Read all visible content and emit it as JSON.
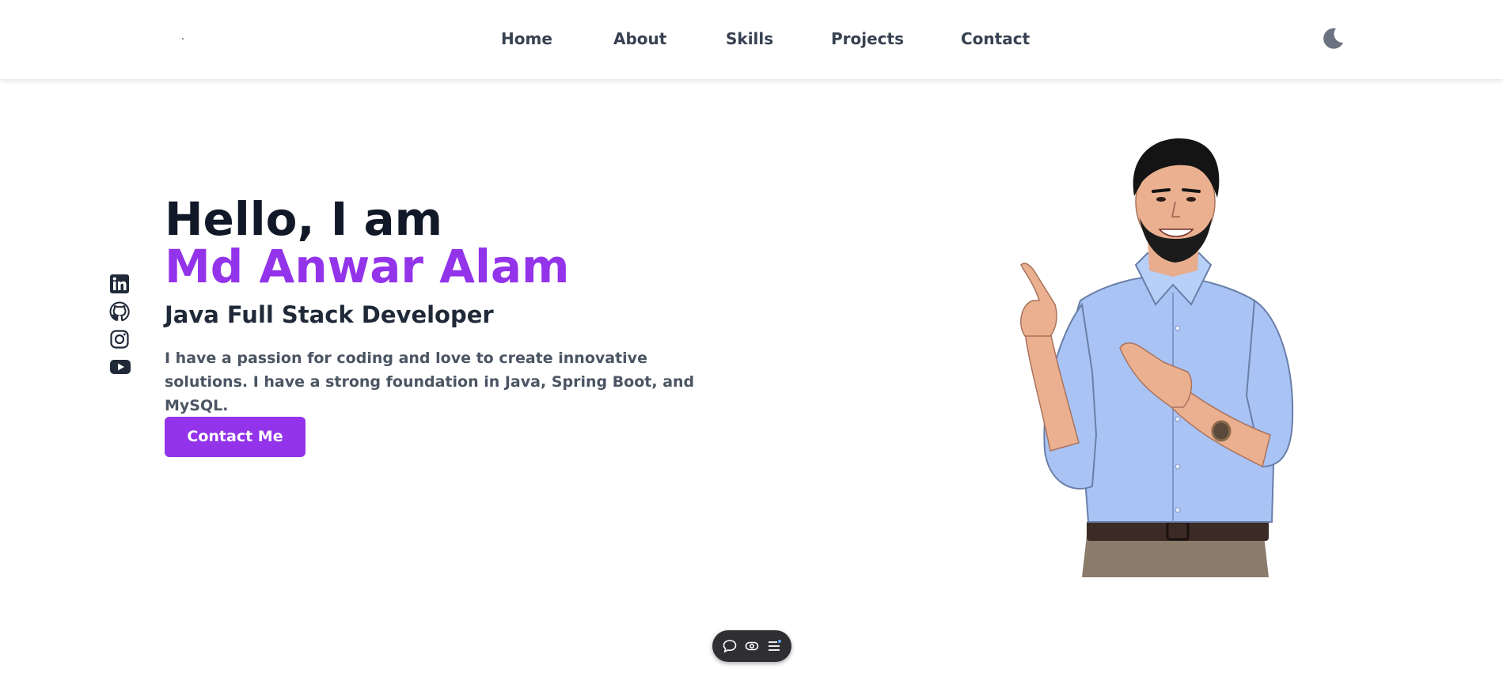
{
  "nav": {
    "items": [
      "Home",
      "About",
      "Skills",
      "Projects",
      "Contact"
    ]
  },
  "theme_toggle": {
    "icon": "moon-icon"
  },
  "social": [
    {
      "name": "linkedin-icon"
    },
    {
      "name": "github-icon"
    },
    {
      "name": "instagram-icon"
    },
    {
      "name": "youtube-icon"
    }
  ],
  "hero": {
    "greeting": "Hello, I am",
    "name": "Md Anwar Alam",
    "role": "Java Full Stack Developer",
    "bio": "I have a passion for coding and love to create innovative solutions. I have a strong foundation in Java, Spring Boot, and MySQL.",
    "cta_label": "Contact Me"
  },
  "toolbar": {
    "buttons": [
      "comment-icon",
      "eye-icon",
      "menu-icon"
    ]
  },
  "colors": {
    "accent": "#9333ea",
    "heading": "#111827",
    "nav_text": "#374151",
    "body_text": "#4b5563",
    "toolbar_bg": "#2f2f33"
  }
}
